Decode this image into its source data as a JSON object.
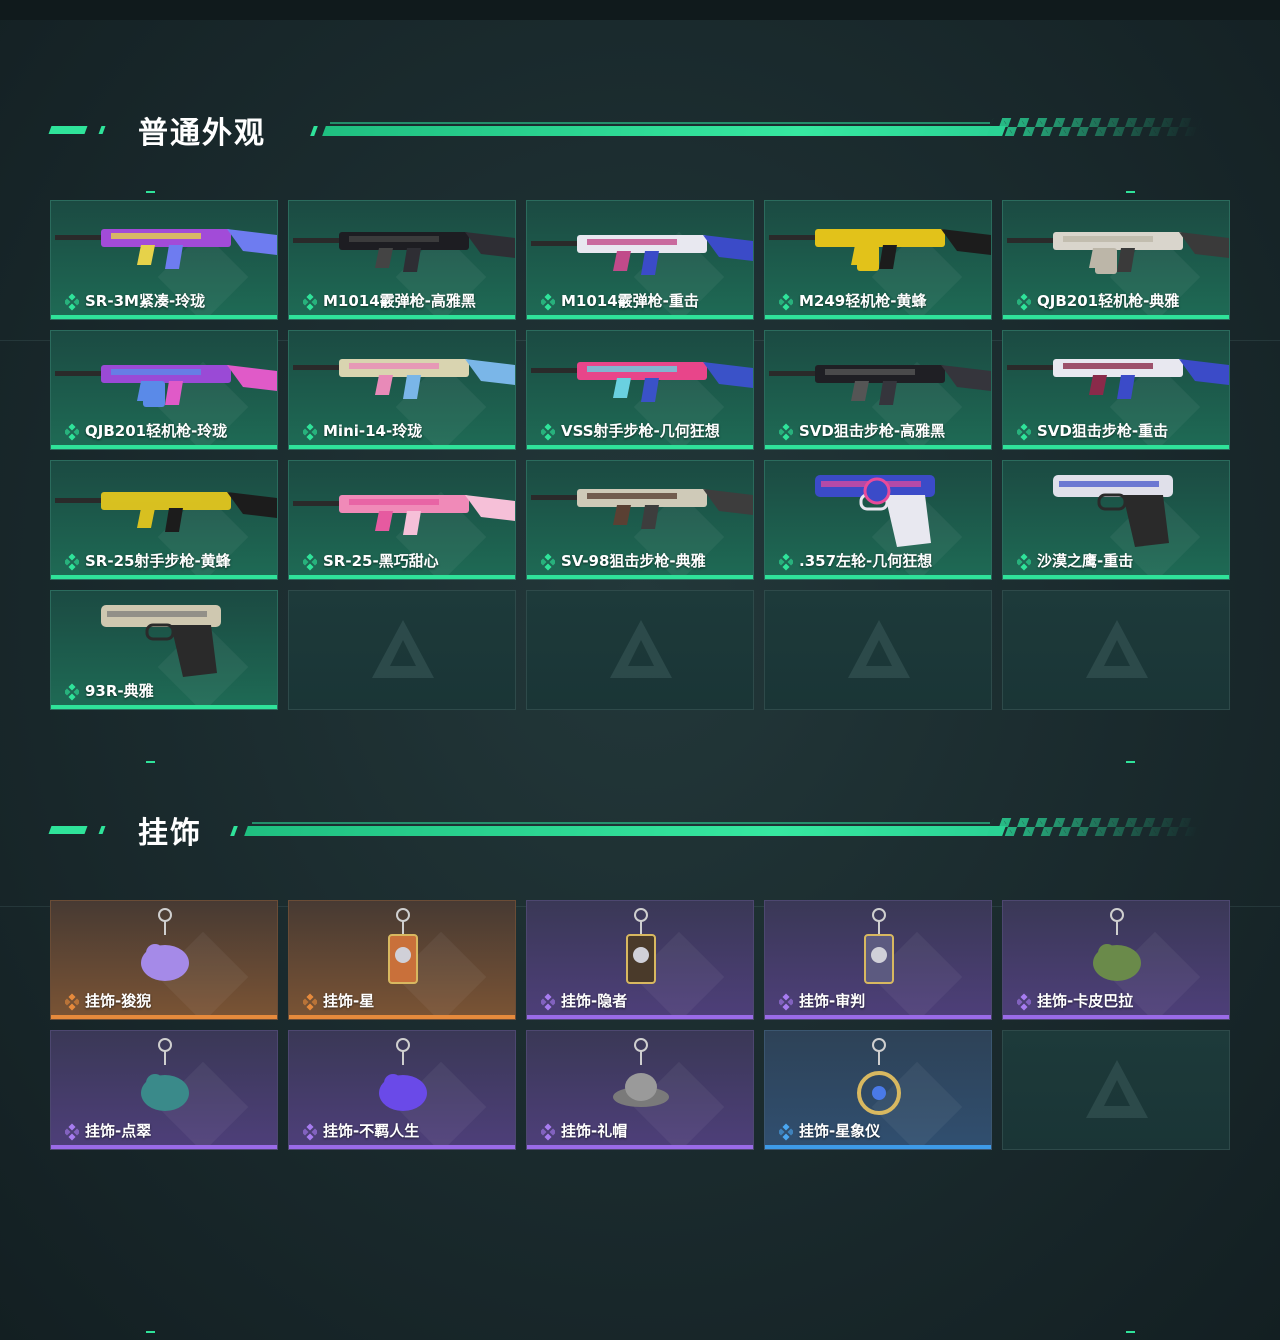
{
  "sections": [
    {
      "title": "普通外观",
      "items": [
        {
          "label": "SR-3M紧凑-玲珑",
          "rarity": "green",
          "icon": "rifle-image"
        },
        {
          "label": "M1014霰弹枪-高雅黑",
          "rarity": "green",
          "icon": "shotgun-image"
        },
        {
          "label": "M1014霰弹枪-重击",
          "rarity": "green",
          "icon": "shotgun-image"
        },
        {
          "label": "M249轻机枪-黄蜂",
          "rarity": "green",
          "icon": "machine-gun-image"
        },
        {
          "label": "QJB201轻机枪-典雅",
          "rarity": "green",
          "icon": "machine-gun-image"
        },
        {
          "label": "QJB201轻机枪-玲珑",
          "rarity": "green",
          "icon": "machine-gun-image"
        },
        {
          "label": "Mini-14-玲珑",
          "rarity": "green",
          "icon": "rifle-image"
        },
        {
          "label": "VSS射手步枪-几何狂想",
          "rarity": "green",
          "icon": "rifle-image"
        },
        {
          "label": "SVD狙击步枪-高雅黑",
          "rarity": "green",
          "icon": "sniper-image"
        },
        {
          "label": "SVD狙击步枪-重击",
          "rarity": "green",
          "icon": "sniper-image"
        },
        {
          "label": "SR-25射手步枪-黄蜂",
          "rarity": "green",
          "icon": "rifle-image"
        },
        {
          "label": "SR-25-黑巧甜心",
          "rarity": "green",
          "icon": "rifle-image"
        },
        {
          "label": "SV-98狙击步枪-典雅",
          "rarity": "green",
          "icon": "sniper-image"
        },
        {
          "label": ".357左轮-几何狂想",
          "rarity": "green",
          "icon": "revolver-image"
        },
        {
          "label": "沙漠之鹰-重击",
          "rarity": "green",
          "icon": "pistol-image"
        },
        {
          "label": "93R-典雅",
          "rarity": "green",
          "icon": "pistol-image"
        }
      ],
      "empty_slots": 4
    },
    {
      "title": "挂饰",
      "items": [
        {
          "label": "挂饰-狻猊",
          "rarity": "orange",
          "icon": "charm-image"
        },
        {
          "label": "挂饰-星",
          "rarity": "orange",
          "icon": "charm-image"
        },
        {
          "label": "挂饰-隐者",
          "rarity": "purple",
          "icon": "charm-image"
        },
        {
          "label": "挂饰-审判",
          "rarity": "purple",
          "icon": "charm-image"
        },
        {
          "label": "挂饰-卡皮巴拉",
          "rarity": "purple",
          "icon": "charm-image"
        },
        {
          "label": "挂饰-点翠",
          "rarity": "purple",
          "icon": "charm-image"
        },
        {
          "label": "挂饰-不羁人生",
          "rarity": "purple",
          "icon": "charm-image"
        },
        {
          "label": "挂饰-礼帽",
          "rarity": "purple",
          "icon": "charm-image"
        },
        {
          "label": "挂饰-星象仪",
          "rarity": "blue",
          "icon": "charm-image"
        }
      ],
      "empty_slots": 1
    }
  ],
  "colors": {
    "accent": "#2fe39a",
    "green_card": "#1e6b55",
    "orange_stripe": "#e68a3c",
    "purple_stripe": "#9a6be8",
    "blue_stripe": "#3e9be8"
  }
}
